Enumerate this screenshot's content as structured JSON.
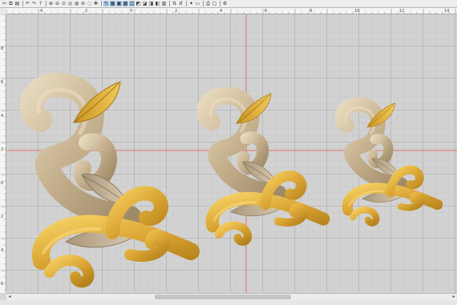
{
  "toolbar": {
    "buttons": [
      {
        "name": "cut",
        "glyph": "✂"
      },
      {
        "name": "copy",
        "glyph": "⧉"
      },
      {
        "name": "paste",
        "glyph": "▤"
      },
      {
        "sep": true
      },
      {
        "name": "undo",
        "glyph": "↶"
      },
      {
        "name": "redo",
        "glyph": "↷"
      },
      {
        "name": "help",
        "glyph": "?"
      },
      {
        "sep": true
      },
      {
        "name": "zoom-in",
        "glyph": "⊕"
      },
      {
        "name": "zoom-out",
        "glyph": "⊖"
      },
      {
        "name": "zoom-fit",
        "glyph": "⊙"
      },
      {
        "name": "zoom-box",
        "glyph": "◎"
      },
      {
        "name": "zoom-1to1",
        "glyph": "◍"
      },
      {
        "name": "zoom-prev",
        "glyph": "⊘"
      },
      {
        "name": "zoom-all",
        "glyph": "◌"
      },
      {
        "name": "pan",
        "glyph": "✥"
      },
      {
        "sep": true
      },
      {
        "name": "select",
        "glyph": "↖",
        "active": true
      },
      {
        "name": "grid",
        "glyph": "▦",
        "active": true
      },
      {
        "name": "hoop",
        "glyph": "▣",
        "active": true
      },
      {
        "name": "stitches",
        "glyph": "▩",
        "active": true
      },
      {
        "name": "outline",
        "glyph": "◫",
        "active": true
      },
      {
        "name": "fill",
        "glyph": "◩"
      },
      {
        "name": "satin",
        "glyph": "◪"
      },
      {
        "name": "run",
        "glyph": "◨"
      },
      {
        "name": "jump",
        "glyph": "◧"
      },
      {
        "name": "trim",
        "glyph": "▥"
      },
      {
        "sep": true
      },
      {
        "name": "stop-sequence",
        "glyph": "⇅"
      },
      {
        "name": "color-sort",
        "glyph": "⇵"
      },
      {
        "sep": true
      },
      {
        "name": "magic-wand",
        "glyph": "✦"
      },
      {
        "name": "measure",
        "glyph": "▭"
      },
      {
        "sep": true
      },
      {
        "name": "print",
        "glyph": "⎙"
      },
      {
        "name": "print-preview",
        "glyph": "▢"
      },
      {
        "sep": true
      },
      {
        "name": "settings",
        "glyph": "⚙"
      }
    ]
  },
  "ruler_top_labels": [
    "4",
    "2",
    "0",
    "2",
    "4",
    "6",
    "8",
    "10",
    "12",
    "14"
  ],
  "ruler_left_labels": [
    "8",
    "6",
    "4",
    "2",
    "0",
    "2",
    "4",
    "6"
  ],
  "colors": {
    "beige": "#c0ad8a",
    "beige_light": "#e1d2b4",
    "gold": "#d8a630",
    "gold_light": "#f0c75a",
    "grid_minor": "#bebebe",
    "grid_major": "#9a9a9a",
    "guide": "#e0524a"
  },
  "scrollbar": {
    "left_arrow": "◂",
    "right_arrow": "▸"
  }
}
